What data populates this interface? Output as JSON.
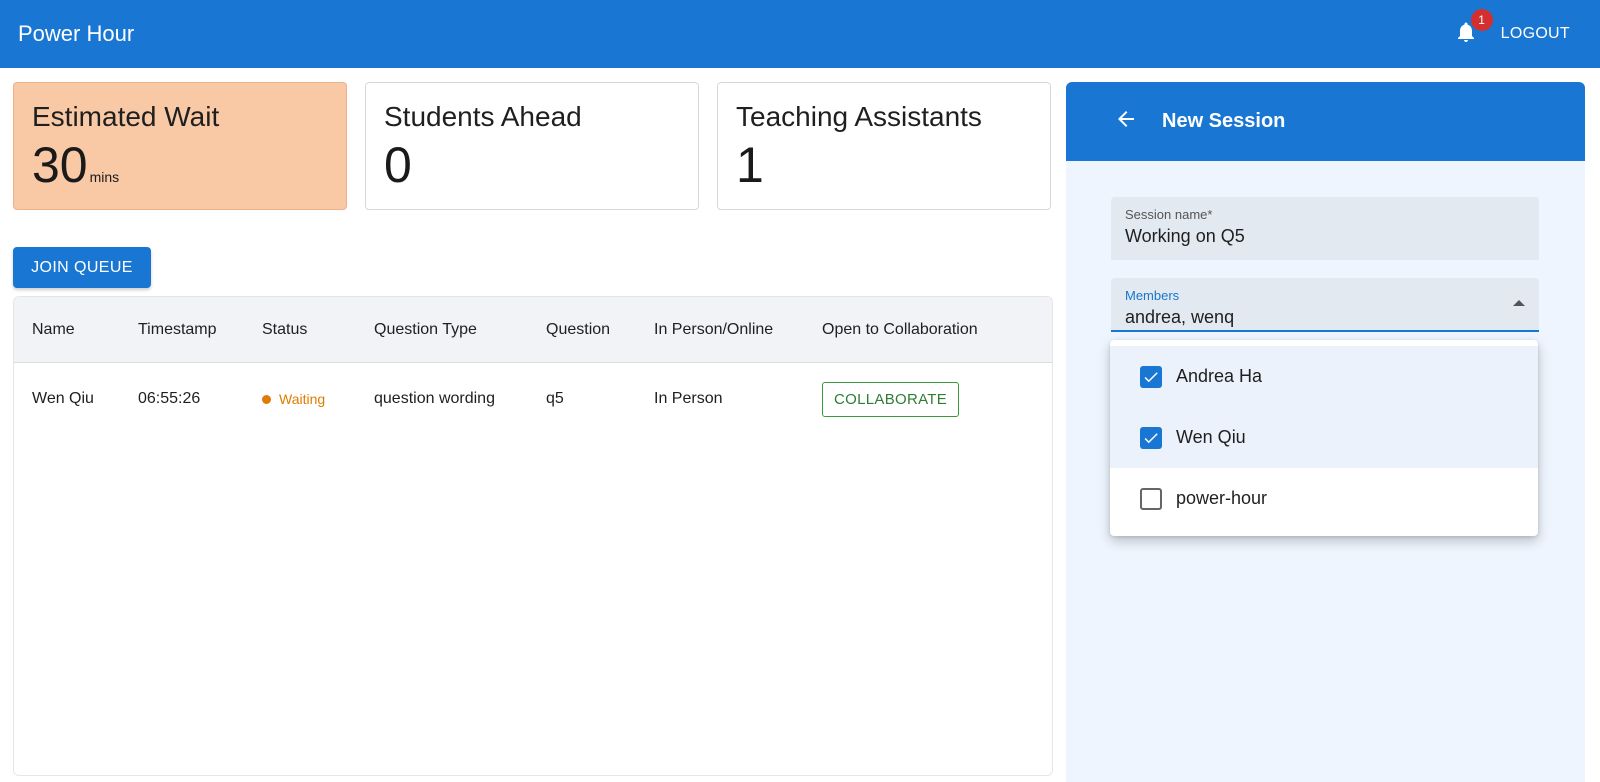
{
  "app": {
    "title": "Power Hour",
    "notifications_count": "1",
    "logout_label": "LOGOUT"
  },
  "stats": [
    {
      "label": "Estimated Wait",
      "value": "30",
      "unit": "mins",
      "color": "#f9c9a6"
    },
    {
      "label": "Students Ahead",
      "value": "0",
      "unit": ""
    },
    {
      "label": "Teaching Assistants",
      "value": "1",
      "unit": ""
    }
  ],
  "queue": {
    "join_label": "JOIN QUEUE",
    "columns": [
      "Name",
      "Timestamp",
      "Status",
      "Question Type",
      "Question",
      "In Person/Online",
      "Open to Collaboration"
    ],
    "rows": [
      {
        "name": "Wen Qiu",
        "timestamp": "06:55:26",
        "status": "Waiting",
        "question_type": "question wording",
        "question": "q5",
        "mode": "In Person",
        "collaboration": "COLLABORATE"
      }
    ]
  },
  "session_panel": {
    "title": "New Session",
    "name_field": {
      "label": "Session name*",
      "value": "Working on Q5"
    },
    "members_field": {
      "label": "Members",
      "value": "andrea, wenq"
    },
    "options": [
      {
        "label": "Andrea Ha",
        "checked": true
      },
      {
        "label": "Wen Qiu",
        "checked": true
      },
      {
        "label": "power-hour",
        "checked": false
      }
    ]
  },
  "colors": {
    "primary": "#1976d2",
    "waiting": "#e07b00",
    "collaborate": "#2e7d32",
    "badge": "#d32f2f"
  }
}
